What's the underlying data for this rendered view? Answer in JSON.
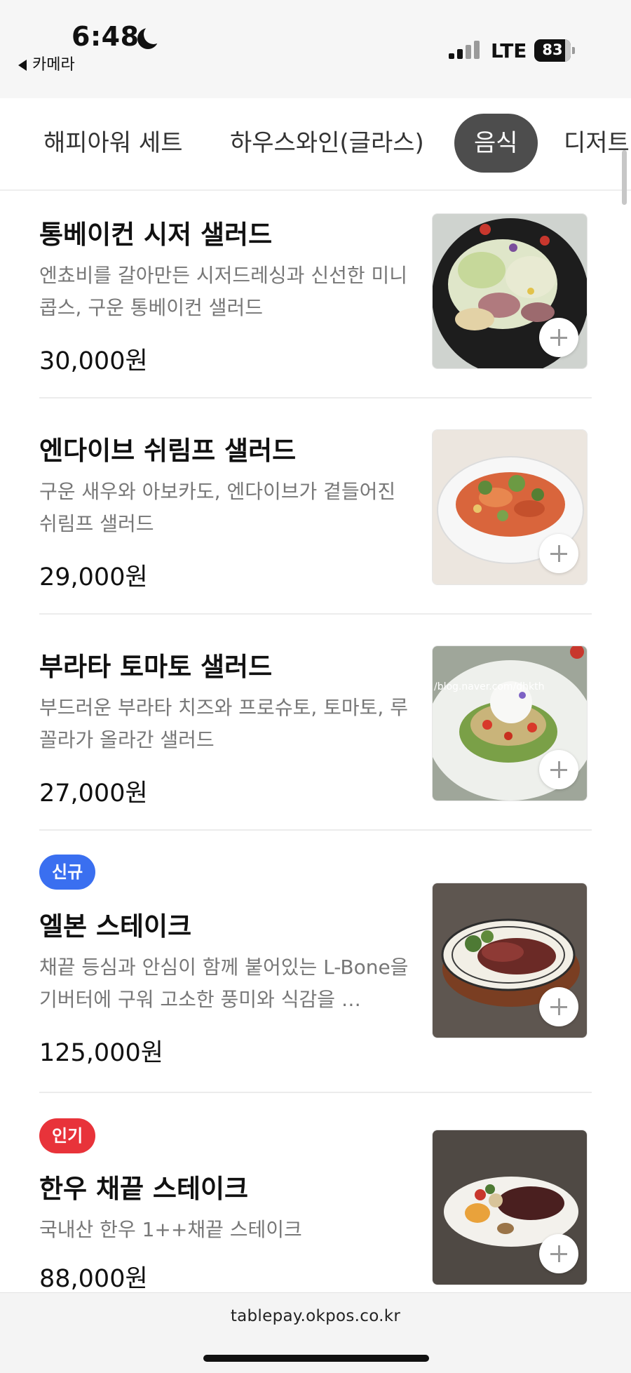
{
  "status_bar": {
    "time": "6:48",
    "back_app": "카메라",
    "network": "LTE",
    "battery": "83"
  },
  "tabs": [
    {
      "label": "해피아워 세트",
      "active": false
    },
    {
      "label": "하우스와인(글라스)",
      "active": false
    },
    {
      "label": "음식",
      "active": true
    },
    {
      "label": "디저트",
      "active": false
    }
  ],
  "menu": {
    "items": [
      {
        "badge": "",
        "name": "통베이컨 시저 샐러드",
        "desc": "엔쵸비를 갈아만든 시저드레싱과 신선한 미니콥스, 구운 통베이컨 샐러드",
        "price": "30,000원"
      },
      {
        "badge": "",
        "name": "엔다이브 쉬림프 샐러드",
        "desc": "구운 새우와 아보카도, 엔다이브가 곁들어진 쉬림프 샐러드",
        "price": "29,000원"
      },
      {
        "badge": "",
        "name": "부라타 토마토 샐러드",
        "desc": "부드러운 부라타 치즈와 프로슈토, 토마토, 루꼴라가 올라간 샐러드",
        "price": "27,000원",
        "image_watermark": "/blog.naver.com/dhkth"
      },
      {
        "badge": "신규",
        "name": "엘본 스테이크",
        "desc": "채끝 등심과 안심이 함께 붙어있는 L-Bone을 기버터에 구워 고소한 풍미와 식감을 …",
        "price": "125,000원"
      },
      {
        "badge": "인기",
        "name": "한우 채끝 스테이크",
        "desc": "국내산 한우 1++채끝 스테이크",
        "price": "88,000원"
      }
    ]
  },
  "browser": {
    "url": "tablepay.okpos.co.kr"
  },
  "colors": {
    "active_tab_bg": "#4d4d4d",
    "badge_new": "#3a6ff0",
    "badge_hot": "#e8333a"
  }
}
